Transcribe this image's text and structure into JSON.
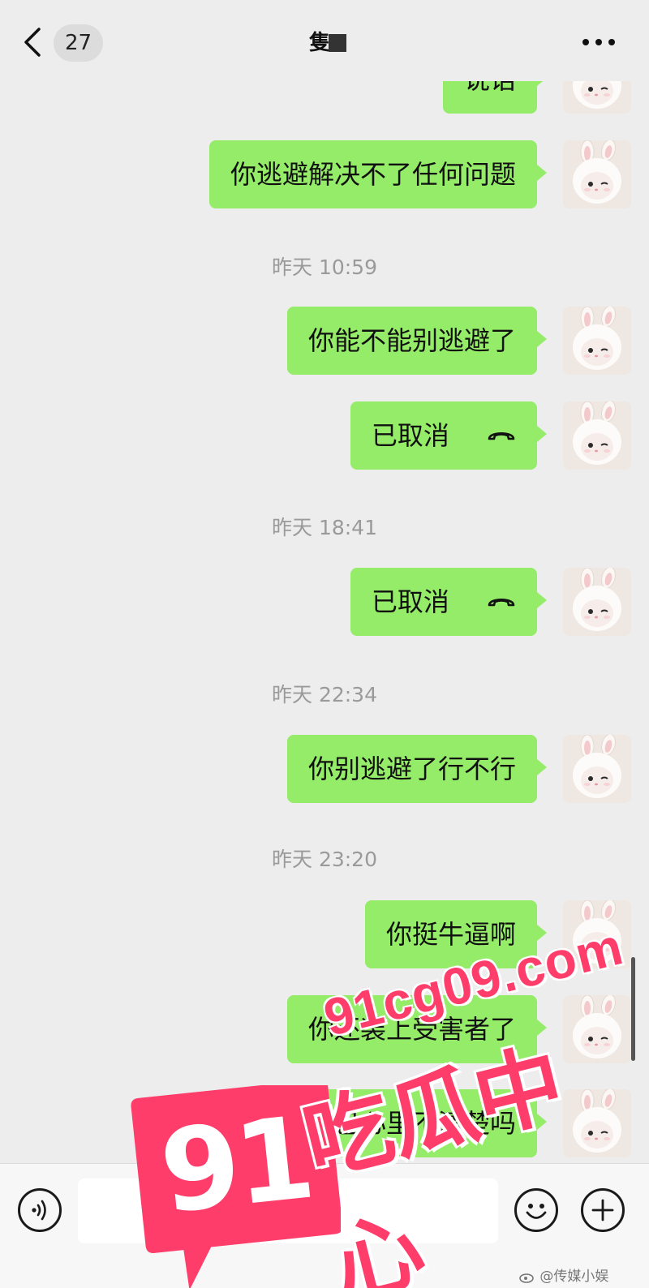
{
  "header": {
    "back_count": "27",
    "contact_name": "隻·"
  },
  "messages": [
    {
      "type": "text",
      "text": "说话",
      "partial": true
    },
    {
      "type": "text",
      "text": "你逃避解决不了任何问题"
    },
    {
      "type": "time",
      "text": "昨天 10:59"
    },
    {
      "type": "text",
      "text": "你能不能别逃避了"
    },
    {
      "type": "call",
      "text": "已取消"
    },
    {
      "type": "time",
      "text": "昨天 18:41"
    },
    {
      "type": "call",
      "text": "已取消"
    },
    {
      "type": "time",
      "text": "昨天 22:34"
    },
    {
      "type": "text",
      "text": "你别逃避了行不行"
    },
    {
      "type": "time",
      "text": "昨天 23:20"
    },
    {
      "type": "text",
      "text": "你挺牛逼啊"
    },
    {
      "type": "text",
      "text": "你还装上受害者了"
    },
    {
      "type": "text",
      "text": "你自己心里不清楚吗"
    }
  ],
  "input": {
    "placeholder": ""
  },
  "watermark": {
    "logo_number": "91",
    "url": "91cg09.com",
    "name": "吃瓜中心"
  },
  "credit": "@传媒小娱",
  "colors": {
    "bubble": "#95ec69",
    "background": "#ededed",
    "watermark": "#ff3d6b"
  },
  "icons": [
    "chevron-left-icon",
    "more-icon",
    "hangup-phone-icon",
    "voice-icon",
    "emoji-icon",
    "plus-icon",
    "cat-avatar-icon",
    "weibo-icon"
  ]
}
